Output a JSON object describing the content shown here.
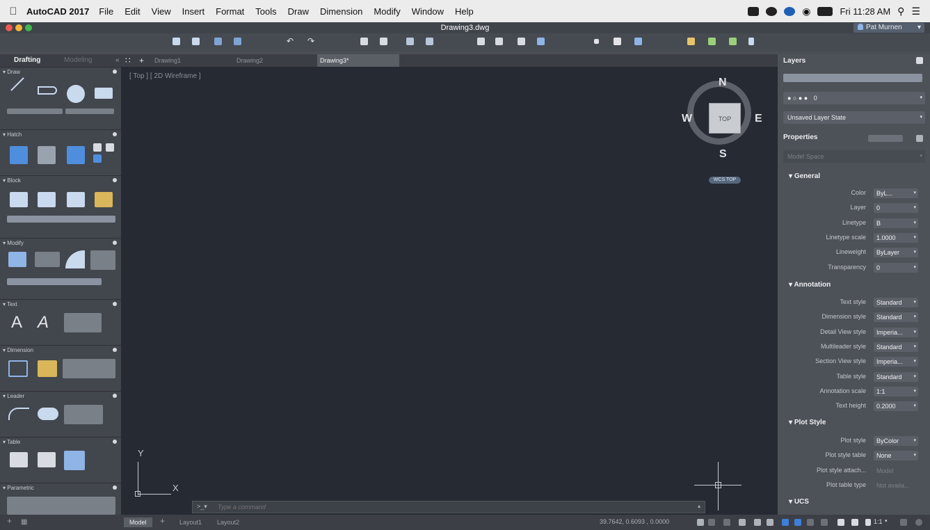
{
  "menubar": {
    "app_name": "AutoCAD 2017",
    "items": [
      "File",
      "Edit",
      "View",
      "Insert",
      "Format",
      "Tools",
      "Draw",
      "Dimension",
      "Modify",
      "Window",
      "Help"
    ],
    "clock": "Fri 11:28 AM"
  },
  "window": {
    "title": "Drawing3.dwg",
    "user": "Pat Murnen"
  },
  "workspaces": {
    "drafting": "Drafting",
    "modeling": "Modeling"
  },
  "doc_tabs": [
    "Drawing1",
    "Drawing2",
    "Drawing3*"
  ],
  "palette": {
    "sections": [
      "Draw",
      "Hatch",
      "Block",
      "Modify",
      "Text",
      "Dimension",
      "Leader",
      "Table",
      "Parametric"
    ]
  },
  "viewport": {
    "view_label": "[ Top ] [ 2D Wireframe ]",
    "compass": {
      "n": "N",
      "s": "S",
      "e": "E",
      "w": "W"
    },
    "viewcube_face": "TOP",
    "ucs_badge": "WCS TOP",
    "axis_y": "Y",
    "axis_x": "X",
    "command_placeholder": "Type a command"
  },
  "right_panel": {
    "layers_title": "Layers",
    "current_layer": "0",
    "layer_state": "Unsaved Layer State",
    "properties_title": "Properties",
    "space": "Model Space",
    "general": {
      "title": "General",
      "rows": [
        {
          "label": "Color",
          "value": "ByL..."
        },
        {
          "label": "Layer",
          "value": "0"
        },
        {
          "label": "Linetype",
          "value": "B"
        },
        {
          "label": "Linetype scale",
          "value": "1.0000"
        },
        {
          "label": "Lineweight",
          "value": "ByLayer"
        },
        {
          "label": "Transparency",
          "value": "0"
        }
      ]
    },
    "annotation": {
      "title": "Annotation",
      "rows": [
        {
          "label": "Text style",
          "value": "Standard"
        },
        {
          "label": "Dimension style",
          "value": "Standard"
        },
        {
          "label": "Detail View style",
          "value": "Imperia..."
        },
        {
          "label": "Multileader style",
          "value": "Standard"
        },
        {
          "label": "Section View style",
          "value": "Imperia..."
        },
        {
          "label": "Table style",
          "value": "Standard"
        },
        {
          "label": "Annotation scale",
          "value": "1:1"
        },
        {
          "label": "Text height",
          "value": "0.2000"
        }
      ]
    },
    "plot_style": {
      "title": "Plot Style",
      "rows": [
        {
          "label": "Plot style",
          "value": "ByColor"
        },
        {
          "label": "Plot style table",
          "value": "None"
        },
        {
          "label": "Plot style attach...",
          "value": "Model"
        },
        {
          "label": "Plot table type",
          "value": "Not availa..."
        }
      ]
    },
    "ucs_title": "UCS"
  },
  "statusbar": {
    "tabs": [
      "Model",
      "Layout1",
      "Layout2"
    ],
    "coords": "39.7642, 0.6093 , 0.0000",
    "scale": "1:1"
  },
  "colors": {
    "viewport_bg": "#252a33",
    "panel_bg": "#4d5158",
    "accent_blue": "#3d7fd9"
  }
}
